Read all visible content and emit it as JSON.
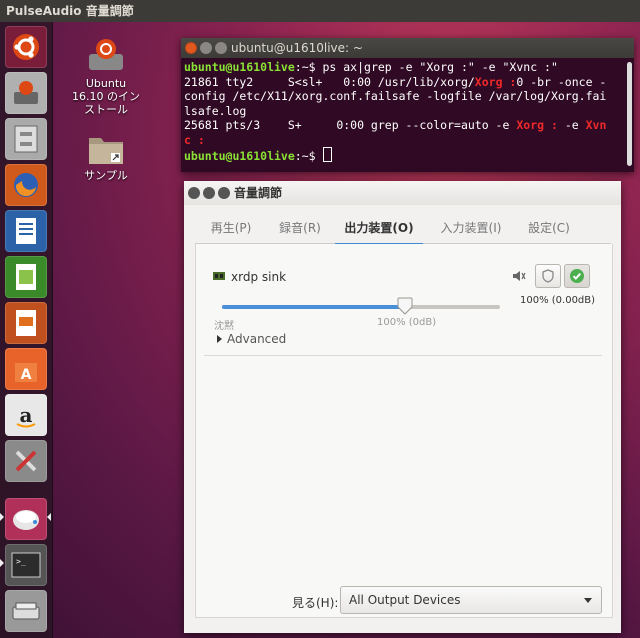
{
  "top_panel": {
    "title": "PulseAudio 音量調節"
  },
  "launcher": {
    "items": [
      {
        "name": "Ubuntu Dash"
      },
      {
        "name": "Ubuntu Installer"
      },
      {
        "name": "Files"
      },
      {
        "name": "Firefox"
      },
      {
        "name": "LibreOffice Writer"
      },
      {
        "name": "LibreOffice Calc"
      },
      {
        "name": "LibreOffice Impress"
      },
      {
        "name": "Ubuntu Software"
      },
      {
        "name": "Amazon"
      },
      {
        "name": "System Settings"
      },
      {
        "name": "PulseAudio Volume Control"
      },
      {
        "name": "Terminal"
      },
      {
        "name": "Disk"
      }
    ]
  },
  "desktop": {
    "icons": [
      {
        "label_line1": "Ubuntu",
        "label_line2": "16.10 のイン",
        "label_line3": "ストール"
      },
      {
        "label_line1": "サンプル"
      }
    ]
  },
  "terminal": {
    "title": "ubuntu@u1610live: ~",
    "prompt_user": "ubuntu@u1610live",
    "prompt_suffix": ":~$",
    "line1_cmd": " ps ax|grep -e \"Xorg :\" -e \"Xvnc :\"",
    "line2a": "21861 tty2     S<sl+   0:00 /usr/lib/xorg/",
    "line2_hl": "Xorg :",
    "line2b": "0 -br -once -",
    "line3": "config /etc/X11/xorg.conf.failsafe -logfile /var/log/Xorg.fai",
    "line4": "lsafe.log",
    "line5a": "25681 pts/3    S+     0:00 grep --color=auto -e ",
    "line5_hl1": "Xorg :",
    "line5b": " -e ",
    "line5_hl2": "Xvn",
    "line6_hl": "c :",
    "line7_cursor": " "
  },
  "volume": {
    "title": "音量調節",
    "tabs": [
      "再生(P)",
      "録音(R)",
      "出力装置(O)",
      "入力装置(I)",
      "設定(C)"
    ],
    "active_tab": 2,
    "device_name": "xrdp sink",
    "volume_readout": "100% (0.00dB)",
    "slider_left_label": "沈黙",
    "slider_mid_label": "100% (0dB)",
    "volume_fraction": 1.0,
    "advanced_label": "Advanced",
    "show_label": "見る(H):",
    "show_value": "All Output Devices",
    "accent": "#4a90d9",
    "check_color": "#4caf50"
  }
}
